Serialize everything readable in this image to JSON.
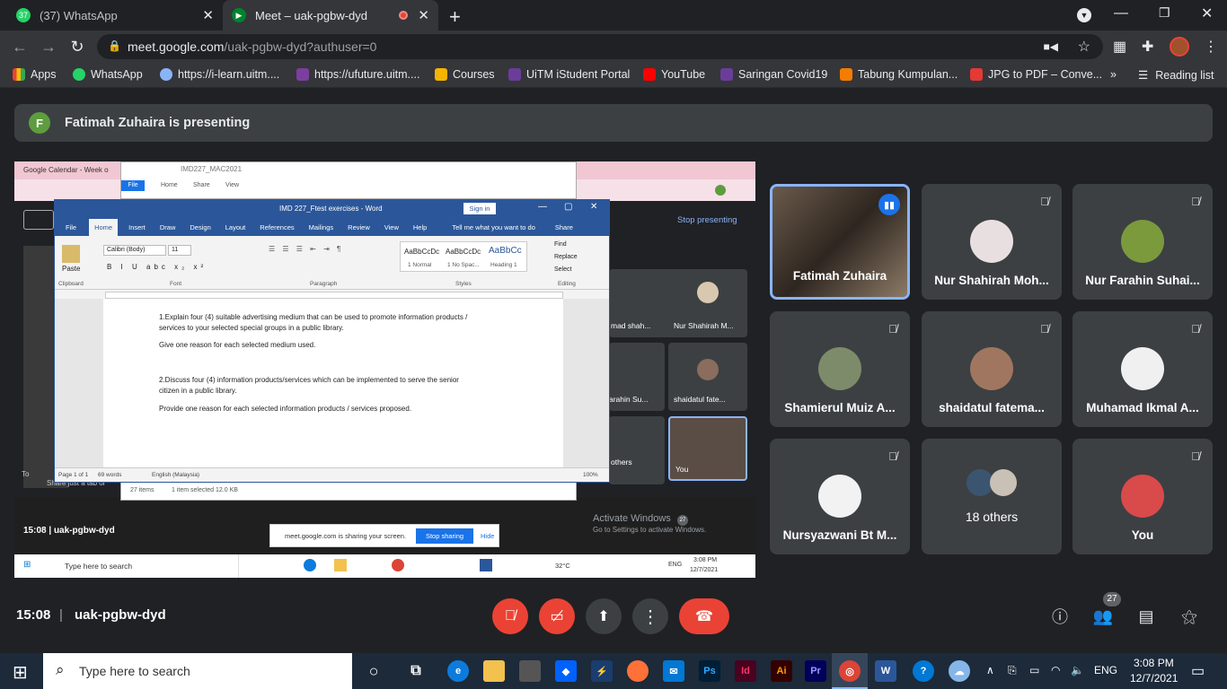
{
  "browser": {
    "tabs": [
      {
        "label": "(37) WhatsApp",
        "badge": "37"
      },
      {
        "label": "Meet – uak-pgbw-dyd"
      }
    ],
    "url_host": "meet.google.com",
    "url_path": "/uak-pgbw-dyd?authuser=0",
    "bookmarks": [
      "Apps",
      "WhatsApp",
      "https://i-learn.uitm....",
      "https://ufuture.uitm....",
      "Courses",
      "UiTM iStudent Portal",
      "YouTube",
      "Saringan Covid19",
      "Tabung Kumpulan...",
      "JPG to PDF – Conve...",
      "Reading list"
    ],
    "whatsapp_badge": "37"
  },
  "meet": {
    "presenter_initial": "F",
    "presenting_text": "Fatimah Zuhaira is presenting",
    "stop_presenting": "Stop presenting",
    "time": "15:08",
    "meeting_code": "uak-pgbw-dyd",
    "participants_count": "27",
    "participants": [
      {
        "name": "Fatimah Zuhaira",
        "speaking": true
      },
      {
        "name": "Nur Shahirah Moh..."
      },
      {
        "name": "Nur Farahin Suhai..."
      },
      {
        "name": "Shamierul Muiz A..."
      },
      {
        "name": "shaidatul fatema..."
      },
      {
        "name": "Muhamad Ikmal A..."
      },
      {
        "name": "Nursyazwani Bt M..."
      },
      {
        "name": "18 others"
      },
      {
        "name": "You"
      }
    ]
  },
  "shared_screen": {
    "calendar_tab": "Google Calendar - Week o",
    "explorer_title": "IMD227_MAC2021",
    "explorer_tabs": [
      "File",
      "Home",
      "Share",
      "View"
    ],
    "explorer_status_items": "27 items",
    "explorer_status_selected": "1 item selected  12.0 KB",
    "word_title": "IMD 227_Ftest exercises - Word",
    "word_signin": "Sign in",
    "word_tabs": [
      "File",
      "Home",
      "Insert",
      "Draw",
      "Design",
      "Layout",
      "References",
      "Mailings",
      "Review",
      "View",
      "Help"
    ],
    "word_tell": "Tell me what you want to do",
    "word_share": "Share",
    "font_name": "Calibri (Body)",
    "font_size": "11",
    "styles": [
      "AaBbCcDc",
      "AaBbCcDc",
      "AaBbCc"
    ],
    "style_names": [
      "1 Normal",
      "1 No Spac...",
      "Heading 1"
    ],
    "groups": [
      "Clipboard",
      "Font",
      "Paragraph",
      "Styles",
      "Editing"
    ],
    "editing": [
      "Find",
      "Replace",
      "Select"
    ],
    "paste": "Paste",
    "doc_q1": "1.Explain four (4) suitable advertising medium that can be used to promote information products /",
    "doc_q1b": "services to your selected  special groups in a public library.",
    "doc_q1c": "Give one  reason for each selected  medium used.",
    "doc_q2": "2.Discuss four (4) information products/services which can be implemented  to serve the senior",
    "doc_q2b": "citizen in a public library.",
    "doc_q2c": "Provide one reason for each selected information products / services proposed.",
    "status_page": "Page 1 of 1",
    "status_words": "69 words",
    "status_lang": "English (Malaysia)",
    "status_zoom": "100%",
    "mini_tiles": [
      "mad shah...",
      "Nur Shahirah M...",
      "arahin Su...",
      "shaidatul fate...",
      "others",
      "You"
    ],
    "mini_count": "27",
    "time": "15:08",
    "meeting_code": "uak-pgbw-dyd",
    "sharing_msg": "meet.google.com is sharing your screen.",
    "stop_sharing": "Stop sharing",
    "hide": "Hide",
    "activate_title": "Activate Windows",
    "activate_sub": "Go to Settings to activate Windows.",
    "taskbar_search": "Type here to search",
    "weather": "32°C",
    "lang": "ENG",
    "clock_time": "3:08 PM",
    "clock_date": "12/7/2021",
    "left_snip_a": "To",
    "left_snip_b": "Share just a tab or"
  },
  "taskbar": {
    "search_placeholder": "Type here to search",
    "lang": "ENG",
    "time": "3:08 PM",
    "date": "12/7/2021"
  }
}
